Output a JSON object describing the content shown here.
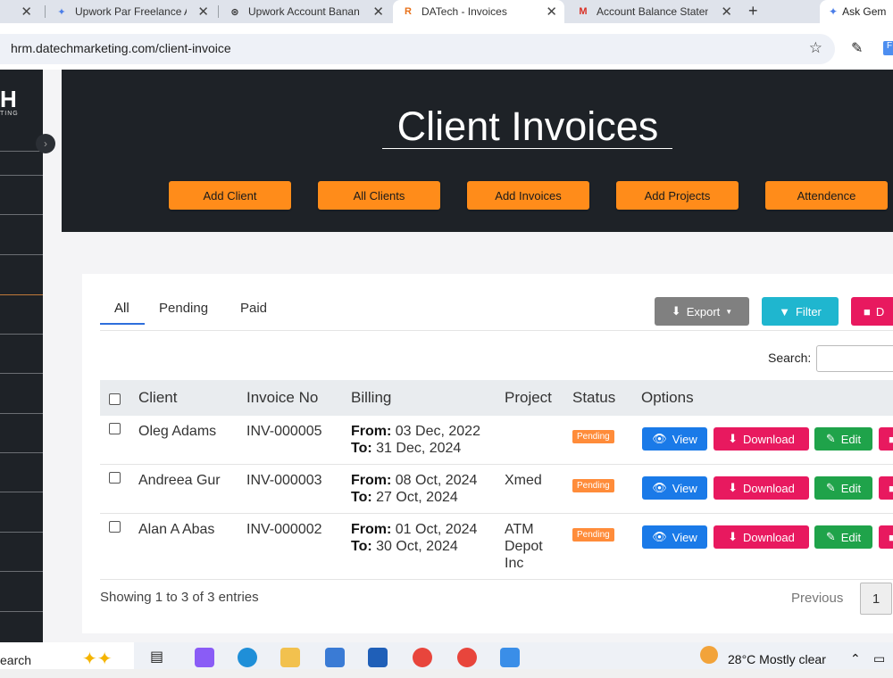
{
  "browser": {
    "tabs": [
      {
        "title": "Upwork Par Freelance A",
        "active": false
      },
      {
        "title": "Upwork Account Banan",
        "active": false
      },
      {
        "title": "DATech - Invoices",
        "active": true
      },
      {
        "title": "Account Balance Staten",
        "active": false
      }
    ],
    "ask_gemini": "Ask Gem",
    "url": "hrm.datechmarketing.com/client-invoice"
  },
  "sidebar": {
    "logo": "H",
    "logo_sub": "TING"
  },
  "header": {
    "title": "Client Invoices",
    "nav": [
      "Add Client",
      "All Clients",
      "Add Invoices",
      "Add Projects",
      "Attendence"
    ]
  },
  "filters": {
    "tabs": [
      "All",
      "Pending",
      "Paid"
    ],
    "active_tab": "All"
  },
  "toolbar": {
    "export_label": "Export",
    "filter_label": "Filter",
    "delete_label": "D",
    "search_label": "Search:"
  },
  "table": {
    "columns": [
      "Client",
      "Invoice No",
      "Billing",
      "Project",
      "Status",
      "Options"
    ],
    "from_label": "From:",
    "to_label": "To:",
    "rows": [
      {
        "client": "Oleg Adams",
        "invoice": "INV-000005",
        "from": "03 Dec, 2022",
        "to": "31 Dec, 2024",
        "project": "",
        "status": "Pending"
      },
      {
        "client": "Andreea Gur",
        "invoice": "INV-000003",
        "from": "08 Oct, 2024",
        "to": "27 Oct, 2024",
        "project": "Xmed",
        "status": "Pending"
      },
      {
        "client": "Alan A Abas",
        "invoice": "INV-000002",
        "from": "01 Oct, 2024",
        "to": "30 Oct, 2024",
        "project": "ATM Depot Inc",
        "status": "Pending"
      }
    ],
    "actions": {
      "view": "View",
      "download": "Download",
      "edit": "Edit"
    }
  },
  "footer": {
    "showing": "Showing 1 to 3 of 3 entries",
    "previous": "Previous",
    "page": "1"
  },
  "taskbar": {
    "search": "earch",
    "weather": "28°C  Mostly clear"
  },
  "colors": {
    "accent_orange": "#ff8c1a",
    "dark_bg": "#1e2227",
    "view_blue": "#1a7ae8",
    "download_pink": "#e8195f",
    "edit_green": "#1fa34a",
    "filter_cyan": "#1fb6cf"
  }
}
